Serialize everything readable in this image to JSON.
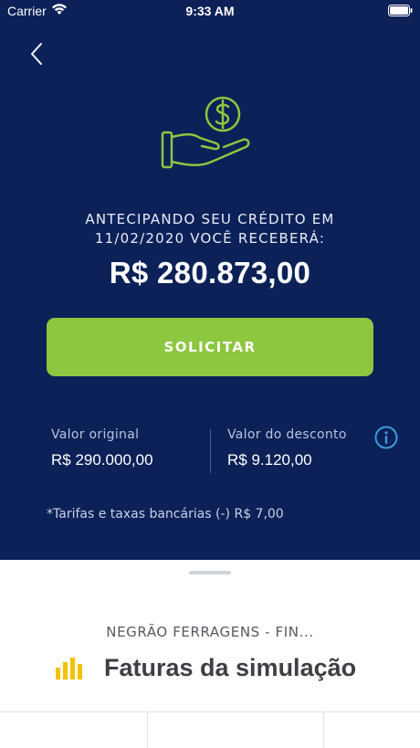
{
  "status_bar": {
    "carrier": "Carrier",
    "time": "9:33 AM"
  },
  "header": {
    "back_icon": "chevron-left-icon"
  },
  "hero": {
    "icon": "hand-dollar-icon",
    "icon_color": "#8dc63f",
    "headline_line1": "ANTECIPANDO SEU CRÉDITO EM",
    "headline_line2": "11/02/2020 VOCÊ RECEBERÁ:",
    "amount": "R$ 280.873,00"
  },
  "actions": {
    "solicitar_label": "SOLICITAR",
    "button_color": "#8dc63f"
  },
  "summary": {
    "original_label": "Valor original",
    "original_value": "R$ 290.000,00",
    "discount_label": "Valor do desconto",
    "discount_value": "R$ 9.120,00",
    "info_icon": "info-icon",
    "fees_text": "*Tarifas e taxas bancárias (-) R$ 7,00"
  },
  "sheet": {
    "company_name": "NEGRÃO FERRAGENS - FIN...",
    "title": "Faturas da simulação",
    "title_icon": "bar-chart-icon",
    "title_icon_color": "#f2c200"
  },
  "theme": {
    "background": "#0b2158",
    "accent": "#8dc63f"
  }
}
